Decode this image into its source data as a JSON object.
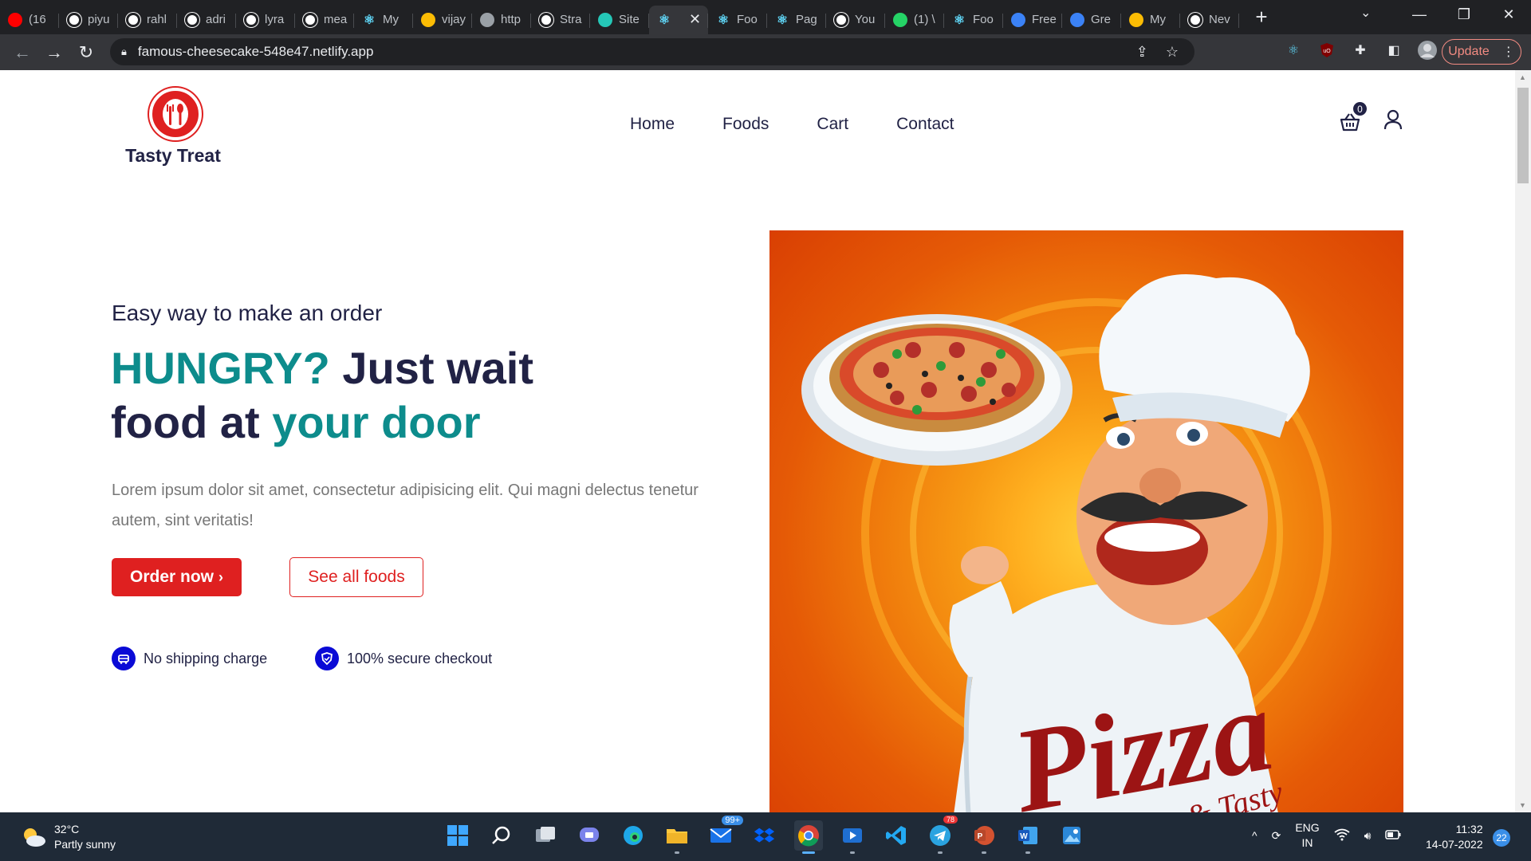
{
  "browser": {
    "tabs": [
      {
        "title": "(16",
        "icon": "youtube-icon",
        "color": "#ff0000"
      },
      {
        "title": "piyu",
        "icon": "github-icon",
        "color": "#ffffff"
      },
      {
        "title": "rahl",
        "icon": "github-icon",
        "color": "#ffffff"
      },
      {
        "title": "adri",
        "icon": "github-icon",
        "color": "#ffffff"
      },
      {
        "title": "lyra",
        "icon": "github-icon",
        "color": "#ffffff"
      },
      {
        "title": "mea",
        "icon": "github-icon",
        "color": "#ffffff"
      },
      {
        "title": "My",
        "icon": "react-icon",
        "color": "#61dafb"
      },
      {
        "title": "vijay",
        "icon": "drive-icon",
        "color": "#fbbc04"
      },
      {
        "title": "http",
        "icon": "api-icon",
        "color": "#9aa0a6"
      },
      {
        "title": "Stra",
        "icon": "wordpress-icon",
        "color": "#ffffff"
      },
      {
        "title": "Site",
        "icon": "netlify-icon",
        "color": "#25c7b7"
      },
      {
        "title": "",
        "icon": "react-icon",
        "color": "#61dafb",
        "active": true
      },
      {
        "title": "Foo",
        "icon": "react-icon",
        "color": "#61dafb"
      },
      {
        "title": "Pag",
        "icon": "react-icon",
        "color": "#61dafb"
      },
      {
        "title": "You",
        "icon": "github-icon",
        "color": "#ffffff"
      },
      {
        "title": "(1) \\",
        "icon": "whatsapp-icon",
        "color": "#25d366"
      },
      {
        "title": "Foo",
        "icon": "react-icon",
        "color": "#61dafb"
      },
      {
        "title": "Free",
        "icon": "codepen-icon",
        "color": "#3b82f6"
      },
      {
        "title": "Gre",
        "icon": "codepen-icon",
        "color": "#3b82f6"
      },
      {
        "title": "My",
        "icon": "drive-icon",
        "color": "#fbbc04"
      },
      {
        "title": "Nev",
        "icon": "chrome-icon",
        "color": "#ffffff"
      }
    ],
    "url": "famous-cheesecake-548e47.netlify.app",
    "update_label": "Update"
  },
  "site": {
    "brand": "Tasty Treat",
    "nav": [
      "Home",
      "Foods",
      "Cart",
      "Contact"
    ],
    "cart_count": "0",
    "subtitle": "Easy way to make an order",
    "headline": {
      "part1": "HUNGRY?",
      "part2": " Just wait",
      "part3": "food at ",
      "part4": "your door"
    },
    "description": "Lorem ipsum dolor sit amet, consectetur adipisicing elit. Qui magni delectus tenetur autem, sint veritatis!",
    "order_button": "Order now",
    "foods_button": "See all foods",
    "features": [
      "No shipping charge",
      "100% secure checkout"
    ],
    "hero_text": {
      "main": "Pizza",
      "sub": "& Tasty"
    },
    "colors": {
      "accent_red": "#df2020",
      "teal": "#0d8c8c",
      "navy": "#212245",
      "feature_blue": "#0a0ad6"
    }
  },
  "taskbar": {
    "weather_temp": "32°C",
    "weather_desc": "Partly sunny",
    "lang_line1": "ENG",
    "lang_line2": "IN",
    "time": "11:32",
    "date": "14-07-2022",
    "notifications": "22",
    "mail_badge": "99+",
    "telegram_badge": "78"
  }
}
